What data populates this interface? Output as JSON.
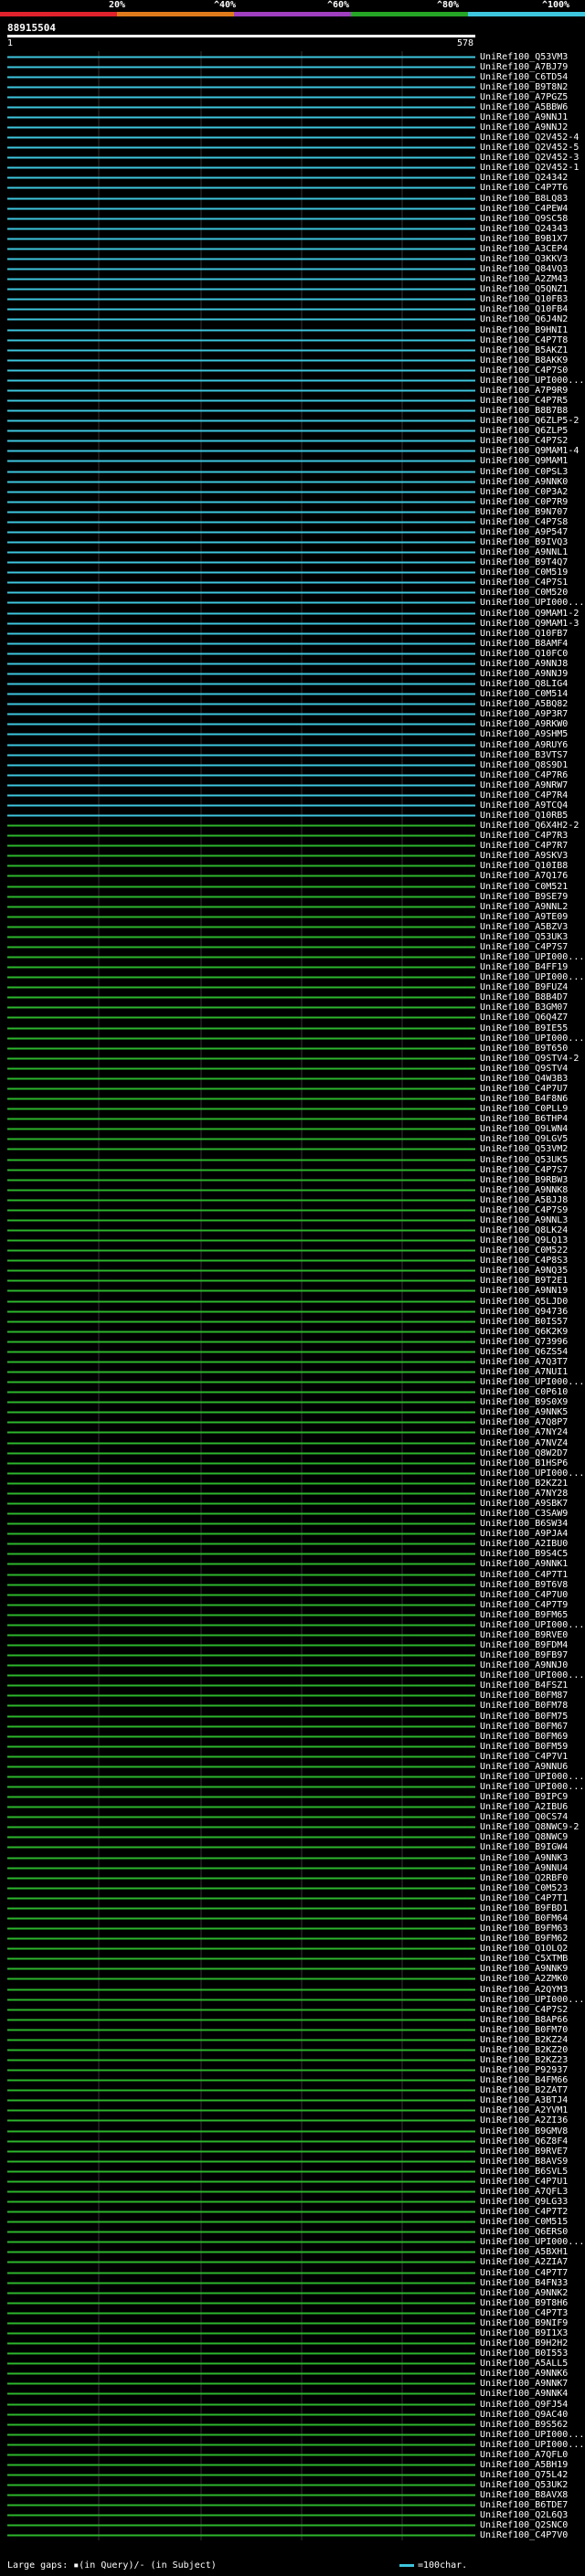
{
  "header": {
    "scale_labels": [
      "20%",
      "^40%",
      "^60%",
      "^80%",
      "^100%"
    ],
    "query_id": "88915504",
    "range_start": "1",
    "range_end": "578"
  },
  "colors": {
    "cyan": "#3ec6de",
    "green": "#2db52d",
    "scale": [
      "#e0222d",
      "#e07b1c",
      "#a03fbf",
      "#26a626",
      "#3ec6de"
    ]
  },
  "hits": [
    "UniRef100_Q53VM3",
    "UniRef100_A7BJ79",
    "UniRef100_C6TD54",
    "UniRef100_B9T8N2",
    "UniRef100_A7PGZ5",
    "UniRef100_A5BBW6",
    "UniRef100_A9NNJ1",
    "UniRef100_A9NNJ2",
    "UniRef100_Q2V452-4",
    "UniRef100_Q2V452-5",
    "UniRef100_Q2V452-3",
    "UniRef100_Q2V452-1",
    "UniRef100_Q24342",
    "UniRef100_C4P7T6",
    "UniRef100_B8LQ83",
    "UniRef100_C4PEW4",
    "UniRef100_Q9SC58",
    "UniRef100_Q24343",
    "UniRef100_B9B1X7",
    "UniRef100_A3CEP4",
    "UniRef100_Q3KKV3",
    "UniRef100_Q84VQ3",
    "UniRef100_A2ZM43",
    "UniRef100_Q5QNZ1",
    "UniRef100_Q10FB3",
    "UniRef100_Q10FB4",
    "UniRef100_Q6J4N2",
    "UniRef100_B9HNI1",
    "UniRef100_C4P7T8",
    "UniRef100_B5AKZ1",
    "UniRef100_B8AKK9",
    "UniRef100_C4P7S0",
    "UniRef100_UPI000...",
    "UniRef100_A7P9R9",
    "UniRef100_C4P7R5",
    "UniRef100_B8B7B8",
    "UniRef100_Q6ZLP5-2",
    "UniRef100_Q6ZLP5",
    "UniRef100_C4P7S2",
    "UniRef100_Q9MAM1-4",
    "UniRef100_Q9MAM1",
    "UniRef100_C0PSL3",
    "UniRef100_A9NNK0",
    "UniRef100_C0P3A2",
    "UniRef100_C0P7R9",
    "UniRef100_B9N707",
    "UniRef100_C4P7S8",
    "UniRef100_A9P547",
    "UniRef100_B9IVQ3",
    "UniRef100_A9NNL1",
    "UniRef100_B9T4Q7",
    "UniRef100_C0M519",
    "UniRef100_C4P7S1",
    "UniRef100_C0M520",
    "UniRef100_UPI000...",
    "UniRef100_Q9MAM1-2",
    "UniRef100_Q9MAM1-3",
    "UniRef100_Q10FB7",
    "UniRef100_B8AMF4",
    "UniRef100_Q10FC0",
    "UniRef100_A9NNJ8",
    "UniRef100_A9NNJ9",
    "UniRef100_Q8LIG4",
    "UniRef100_C0M514",
    "UniRef100_A5BQ82",
    "UniRef100_A9P3R7",
    "UniRef100_A9RKW0",
    "UniRef100_A9SHM5",
    "UniRef100_A9RUY6",
    "UniRef100_B3VTS7",
    "UniRef100_Q8S9D1",
    "UniRef100_C4P7R6",
    "UniRef100_A9NRW7",
    "UniRef100_C4P7R4",
    "UniRef100_A9TCQ4",
    "UniRef100_Q10RB5",
    "UniRef100_Q6X4H2-2",
    "UniRef100_C4P7R3",
    "UniRef100_C4P7R7",
    "UniRef100_A9SKV3",
    "UniRef100_Q10IB8",
    "UniRef100_A7Q176",
    "UniRef100_C0M521",
    "UniRef100_B9SE79",
    "UniRef100_A9NNL2",
    "UniRef100_A9TE09",
    "UniRef100_A5BZV3",
    "UniRef100_Q53UK3",
    "UniRef100_C4P7S7",
    "UniRef100_UPI000...",
    "UniRef100_B4FF19",
    "UniRef100_UPI000...",
    "UniRef100_B9FUZ4",
    "UniRef100_B8B4D7",
    "UniRef100_B3GM07",
    "UniRef100_Q6Q4Z7",
    "UniRef100_B9IE55",
    "UniRef100_UPI000...",
    "UniRef100_B9T650",
    "UniRef100_Q9STV4-2",
    "UniRef100_Q9STV4",
    "UniRef100_Q4W3B3",
    "UniRef100_C4P7U7",
    "UniRef100_B4F8N6",
    "UniRef100_C0PLL9",
    "UniRef100_B6THP4",
    "UniRef100_Q9LWN4",
    "UniRef100_Q9LGV5",
    "UniRef100_Q53VM2",
    "UniRef100_Q53UK5",
    "UniRef100_C4P7S7",
    "UniRef100_B9RBW3",
    "UniRef100_A9NNK8",
    "UniRef100_A5BJJ8",
    "UniRef100_C4P7S9",
    "UniRef100_A9NNL3",
    "UniRef100_Q8LK24",
    "UniRef100_Q9LQ13",
    "UniRef100_C0M522",
    "UniRef100_C4P8S3",
    "UniRef100_A9NQ35",
    "UniRef100_B9T2E1",
    "UniRef100_A9NN19",
    "UniRef100_Q5LJD0",
    "UniRef100_Q94736",
    "UniRef100_B0IS57",
    "UniRef100_Q6K2K9",
    "UniRef100_Q73996",
    "UniRef100_Q6ZS54",
    "UniRef100_A7Q3T7",
    "UniRef100_A7NUI1",
    "UniRef100_UPI000...",
    "UniRef100_C0P610",
    "UniRef100_B9S0X9",
    "UniRef100_A9NNK5",
    "UniRef100_A7Q8P7",
    "UniRef100_A7NY24",
    "UniRef100_A7NVZ4",
    "UniRef100_Q8W2D7",
    "UniRef100_B1HSP6",
    "UniRef100_UPI000...",
    "UniRef100_B2KZ21",
    "UniRef100_A7NY28",
    "UniRef100_A9SBK7",
    "UniRef100_C3SAW9",
    "UniRef100_B6SW34",
    "UniRef100_A9PJA4",
    "UniRef100_A2IBU0",
    "UniRef100_B9S4C5",
    "UniRef100_A9NNK1",
    "UniRef100_C4P7T1",
    "UniRef100_B9T6V8",
    "UniRef100_C4P7U0",
    "UniRef100_C4P7T9",
    "UniRef100_B9FM65",
    "UniRef100_UPI000...",
    "UniRef100_B9RVE0",
    "UniRef100_B9FDM4",
    "UniRef100_B9FB97",
    "UniRef100_A9NNJ0",
    "UniRef100_UPI000...",
    "UniRef100_B4FSZ1",
    "UniRef100_B0FM87",
    "UniRef100_B0FM78",
    "UniRef100_B0FM75",
    "UniRef100_B0FM67",
    "UniRef100_B0FM69",
    "UniRef100_B0FM59",
    "UniRef100_C4P7V1",
    "UniRef100_A9NNU6",
    "UniRef100_UPI000...",
    "UniRef100_UPI000...",
    "UniRef100_B9IPC9",
    "UniRef100_A2IBU6",
    "UniRef100_Q0CS74",
    "UniRef100_Q8NWC9-2",
    "UniRef100_Q8NWC9",
    "UniRef100_B9IGW4",
    "UniRef100_A9NNK3",
    "UniRef100_A9NNU4",
    "UniRef100_Q2RBF0",
    "UniRef100_C0M523",
    "UniRef100_C4P7T1",
    "UniRef100_B9FBD1",
    "UniRef100_B0FM64",
    "UniRef100_B9FM63",
    "UniRef100_B9FM62",
    "UniRef100_Q1OLQ2",
    "UniRef100_C5XTMB",
    "UniRef100_A9NNK9",
    "UniRef100_A2ZMK0",
    "UniRef100_A2QYM3",
    "UniRef100_UPI000...",
    "UniRef100_C4P7S2",
    "UniRef100_B8AP66",
    "UniRef100_B0FM70",
    "UniRef100_B2KZ24",
    "UniRef100_B2KZ20",
    "UniRef100_B2KZ23",
    "UniRef100_P92937",
    "UniRef100_B4FM66",
    "UniRef100_B2ZAT7",
    "UniRef100_A3BTJ4",
    "UniRef100_A2YVM1",
    "UniRef100_A2ZI36",
    "UniRef100_B9GMV8",
    "UniRef100_Q6Z8F4",
    "UniRef100_B9RVE7",
    "UniRef100_B8AVS9",
    "UniRef100_B6SVL5",
    "UniRef100_C4P7U1",
    "UniRef100_A7QFL3",
    "UniRef100_Q9LG33",
    "UniRef100_C4P7T2",
    "UniRef100_C0M515",
    "UniRef100_Q6ERS0",
    "UniRef100_UPI000...",
    "UniRef100_A5BXH1",
    "UniRef100_A2ZIA7",
    "UniRef100_C4P7T7",
    "UniRef100_B4FN33",
    "UniRef100_A9NNK2",
    "UniRef100_B9T8H6",
    "UniRef100_C4P7T3",
    "UniRef100_B9NIF9",
    "UniRef100_B9I1X3",
    "UniRef100_B9H2H2",
    "UniRef100_B0I553",
    "UniRef100_A5ALL5",
    "UniRef100_A9NNK6",
    "UniRef100_A9NNK7",
    "UniRef100_A9NNK4",
    "UniRef100_Q9FJ54",
    "UniRef100_Q9AC40",
    "UniRef100_B9S562",
    "UniRef100_UPI000...",
    "UniRef100_UPI000...",
    "UniRef100_A7QFL0",
    "UniRef100_A5BH19",
    "UniRef100_Q75L42",
    "UniRef100_Q53UK2",
    "UniRef100_B8AVX8",
    "UniRef100_B6TDE7",
    "UniRef100_Q2L6Q3",
    "UniRef100_Q2SNC0",
    "UniRef100_C4P7V0"
  ],
  "footer": {
    "large_gaps": "Large gaps: ▪(in Query)/- (in Subject)",
    "legend": "=100char."
  }
}
